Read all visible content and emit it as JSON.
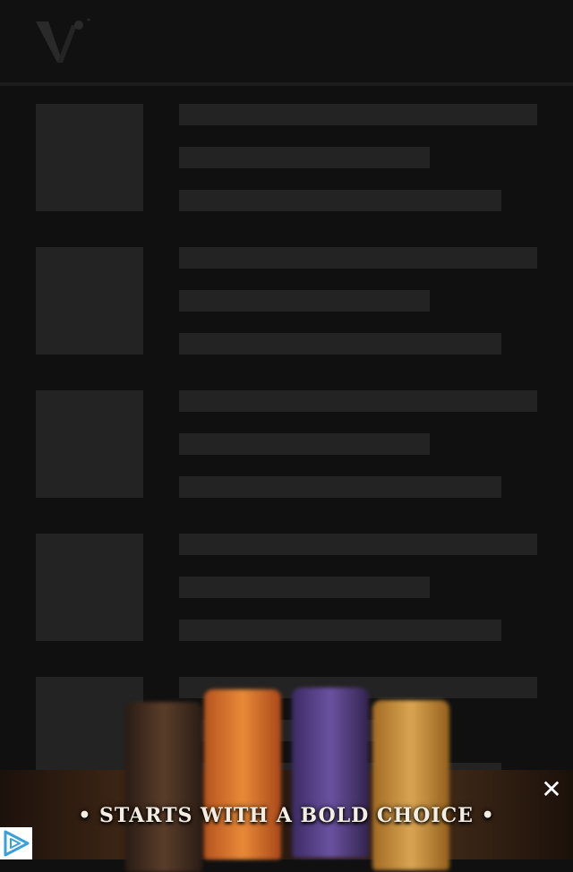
{
  "header": {
    "logo_icon": "v-logo-icon"
  },
  "feed": {
    "placeholder_rows": 5
  },
  "ad": {
    "tagline": "• STARTS WITH A BOLD CHOICE •",
    "close_icon": "close-icon",
    "badge_icon": "adchoices-play-icon"
  },
  "colors": {
    "background": "#101010",
    "placeholder": "#232323",
    "badge_accent": "#3aa0d8"
  }
}
